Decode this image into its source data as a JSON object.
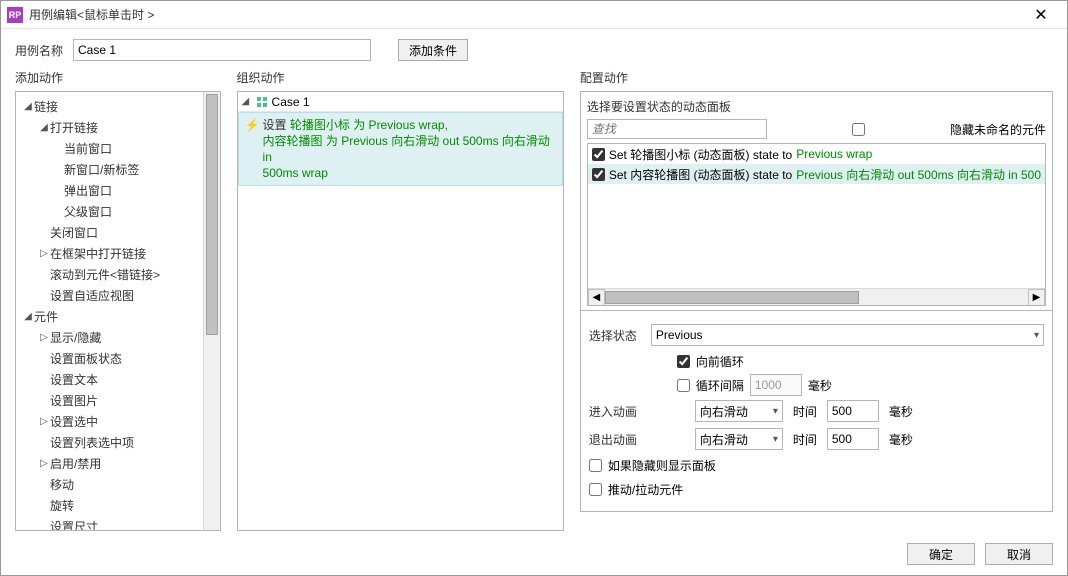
{
  "window": {
    "title": "用例编辑<鼠标单击时 >"
  },
  "header": {
    "case_label": "用例名称",
    "case_value": "Case 1",
    "condition_btn": "添加条件"
  },
  "cols": {
    "add": "添加动作",
    "org": "组织动作",
    "cfg": "配置动作"
  },
  "actions_tree": {
    "link": "链接",
    "open_link": "打开链接",
    "cur_win": "当前窗口",
    "new_tab": "新窗口/新标签",
    "popup": "弹出窗口",
    "parent": "父级窗口",
    "close_win": "关闭窗口",
    "open_frame": "在框架中打开链接",
    "scroll_to": "滚动到元件<错链接>",
    "set_adaptive": "设置自适应视图",
    "widgets": "元件",
    "show_hide": "显示/隐藏",
    "panel_state": "设置面板状态",
    "set_text": "设置文本",
    "set_image": "设置图片",
    "set_selected": "设置选中",
    "set_list_sel": "设置列表选中项",
    "enable_disable": "启用/禁用",
    "move": "移动",
    "rotate": "旋转",
    "set_size": "设置尺寸"
  },
  "case": {
    "name": "Case 1",
    "action_verb": "设置",
    "seg1_green": "轮播图小标 为 Previous wrap,",
    "seg2a": "内容轮播图 为 Previous 向右滑动 out 500ms 向右滑动 in",
    "seg2b": "500ms wrap"
  },
  "config": {
    "panel_header": "选择要设置状态的动态面板",
    "search_placeholder": "查找",
    "hide_unnamed": "隐藏未命名的元件",
    "targets": [
      {
        "label": "Set 轮播图小标 (动态面板) state to ",
        "green": "Previous wrap",
        "selected": false,
        "checked": true
      },
      {
        "label": "Set 内容轮播图 (动态面板) state to ",
        "green": "Previous 向右滑动 out 500ms 向右滑动 in 500",
        "selected": true,
        "checked": true
      }
    ],
    "state_label": "选择状态",
    "state_value": "Previous",
    "loop_front": "向前循环",
    "interval_label": "循环间隔",
    "interval_value": "1000",
    "ms": "毫秒",
    "enter_anim": "进入动画",
    "exit_anim": "退出动画",
    "anim_value": "向右滑动",
    "time_label": "时间",
    "time_value": "500",
    "show_if_hidden": "如果隐藏则显示面板",
    "pull_push": "推动/拉动元件"
  },
  "footer": {
    "ok": "确定",
    "cancel": "取消"
  }
}
